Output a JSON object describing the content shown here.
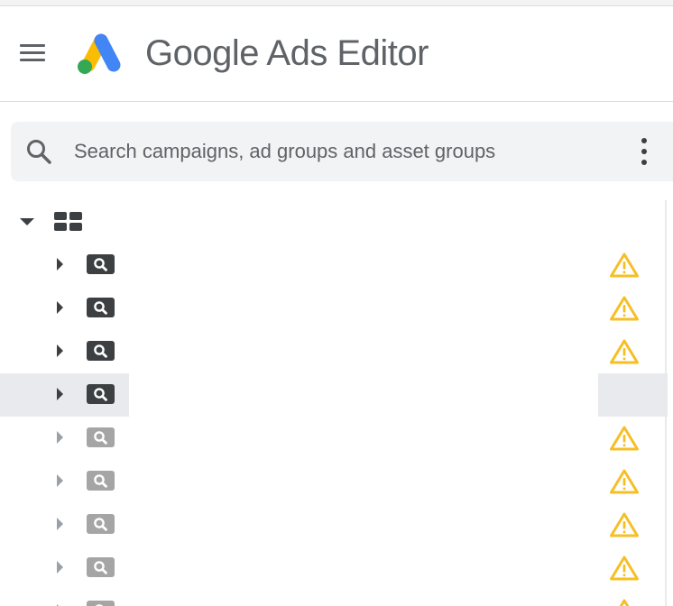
{
  "app": {
    "title": "Google Ads Editor",
    "menu_icon": "hamburger-menu-icon",
    "logo_icon": "google-ads-logo-icon"
  },
  "search": {
    "placeholder": "Search campaigns, ad groups and asset groups",
    "value": "",
    "icon": "search-icon",
    "more_icon": "more-vert-icon"
  },
  "tree": {
    "root": {
      "expanded": true,
      "icon": "account-grid-icon"
    },
    "campaigns": [
      {
        "status": "enabled",
        "warning": true,
        "selected": false
      },
      {
        "status": "enabled",
        "warning": true,
        "selected": false
      },
      {
        "status": "enabled",
        "warning": true,
        "selected": false
      },
      {
        "status": "enabled",
        "warning": false,
        "selected": true
      },
      {
        "status": "paused",
        "warning": true,
        "selected": false
      },
      {
        "status": "paused",
        "warning": true,
        "selected": false
      },
      {
        "status": "paused",
        "warning": true,
        "selected": false
      },
      {
        "status": "paused",
        "warning": true,
        "selected": false
      },
      {
        "status": "paused",
        "warning": true,
        "selected": false
      }
    ]
  },
  "colors": {
    "ads_blue": "#4285F4",
    "ads_yellow": "#FBBC04",
    "ads_green": "#34A853",
    "warning": "#F6BF26",
    "selected_row": "#E8EAED",
    "search_bg": "#F1F3F4"
  }
}
